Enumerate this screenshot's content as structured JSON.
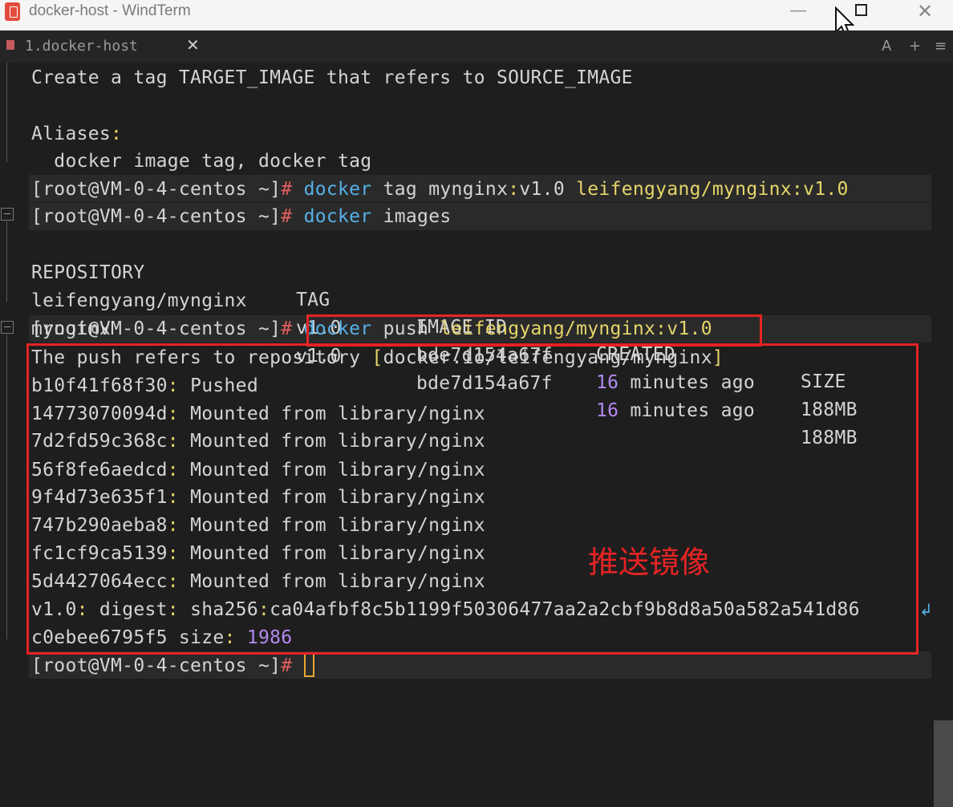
{
  "window": {
    "title": "docker-host - WindTerm",
    "minimize": "—",
    "close": "✕"
  },
  "tab": {
    "label": "1.docker-host",
    "close": "✕",
    "font_icon": "A",
    "add_icon": "+",
    "menu_icon": "≡"
  },
  "terminal": {
    "help_line": "Create a tag TARGET_IMAGE that refers to SOURCE_IMAGE",
    "aliases_label": "Aliases",
    "aliases_colon": ":",
    "aliases_value": "  docker image tag, docker tag",
    "prompt": "[root@VM-0-4-centos ~]",
    "hash": "#",
    "cmd1": {
      "docker": "docker",
      "rest1": " tag mynginx",
      "colon": ":",
      "rest2": "v1.0 ",
      "target": "leifengyang/mynginx:v1.0"
    },
    "cmd2": {
      "docker": "docker",
      "rest": " images"
    },
    "images_table": {
      "headers": [
        "REPOSITORY",
        "TAG",
        "IMAGE ID",
        "CREATED",
        "SIZE"
      ],
      "rows": [
        {
          "repo": "leifengyang/mynginx",
          "tag": "v1.0",
          "id": "bde7d154a67f",
          "created_num": "16",
          "created_rest": " minutes ago",
          "size": "188MB"
        },
        {
          "repo": "mynginx",
          "tag": "v1.0",
          "id": "bde7d154a67f",
          "created_num": "16",
          "created_rest": " minutes ago",
          "size": "188MB"
        }
      ]
    },
    "cmd3": {
      "docker": "docker",
      "rest": " push ",
      "target": "leifengyang/mynginx:v1.0"
    },
    "push_ref": {
      "text": "The push refers to repository ",
      "lb": "[",
      "repo": "docker.io/leifengyang/mynginx",
      "rb": "]"
    },
    "layers": [
      {
        "id": "b10f41f68f30",
        "status": " Pushed"
      },
      {
        "id": "14773070094d",
        "status": " Mounted from library/nginx"
      },
      {
        "id": "7d2fd59c368c",
        "status": " Mounted from library/nginx"
      },
      {
        "id": "56f8fe6aedcd",
        "status": " Mounted from library/nginx"
      },
      {
        "id": "9f4d73e635f1",
        "status": " Mounted from library/nginx"
      },
      {
        "id": "747b290aeba8",
        "status": " Mounted from library/nginx"
      },
      {
        "id": "fc1cf9ca5139",
        "status": " Mounted from library/nginx"
      },
      {
        "id": "5d4427064ecc",
        "status": " Mounted from library/nginx"
      }
    ],
    "digest": {
      "tag": "v1.0",
      "label": " digest",
      "algo": " sha256",
      "hash1": "ca04afbf8c5b1199f50306477aa2a2cbf9b8d8a50a582a541d86",
      "hash2": "c0ebee6795f5",
      "size_label": " size",
      "size": " 1986"
    },
    "annotation": "推送镜像"
  },
  "colors": {
    "background": "#1e1e1e",
    "command": "#57b0e8",
    "highlight_yellow": "#e6d56a",
    "number_purple": "#b489f0",
    "prompt_hash": "#e25f5f",
    "annotation_red": "#e52424"
  }
}
